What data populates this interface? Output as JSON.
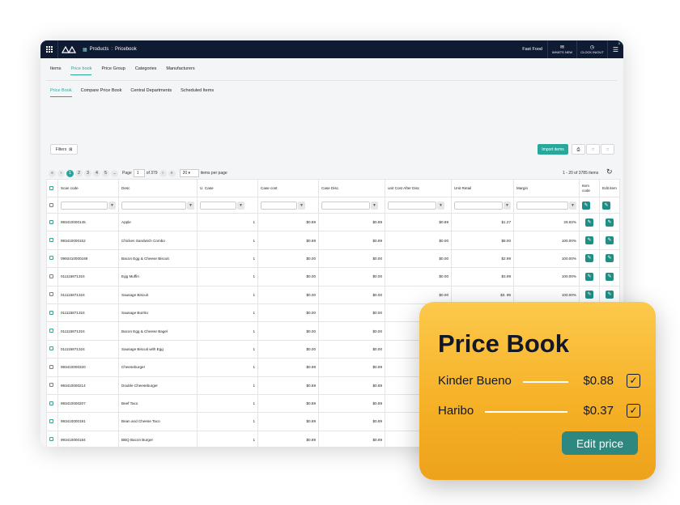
{
  "topbar": {
    "breadcrumb_root": "Products",
    "breadcrumb_sep": ":",
    "breadcrumb_page": "Pricebook",
    "store": "Fast Food",
    "whats_new": "WHAT'S NEW",
    "clock": "CLOCK IN/OUT",
    "badge": "0"
  },
  "tabs_main": [
    "Items",
    "Price book",
    "Price Group",
    "Categories",
    "Manufacturers"
  ],
  "tabs_sub": [
    "Price Book",
    "Compare Price Book",
    "Central Departments",
    "Scheduled Items"
  ],
  "filters_label": "Filters",
  "import_label": "Import items",
  "pager": {
    "pages": [
      "1",
      "2",
      "3",
      "4",
      "5",
      "..."
    ],
    "page_label": "Page",
    "page_value": "1",
    "of_label": "of 379",
    "per_page": "20",
    "per_page_label": "items per page",
    "range": "1 - 20 of 3785 items"
  },
  "columns": [
    "Scan code",
    "Desc",
    "U. Case",
    "Case cost",
    "Case Disc.",
    "unit Cost After Disc",
    "Unit Retail",
    "Margin",
    "Item code",
    "Edit item"
  ],
  "rows": [
    {
      "scan": "993410000145",
      "desc": "Apple",
      "ucase": "1",
      "cost": "$0.89",
      "disc": "$0.89",
      "unit": "$0.89",
      "retail": "$1.27",
      "margin": "29.92%"
    },
    {
      "scan": "993410000152",
      "desc": "Chicken Sandwich Combo",
      "ucase": "1",
      "cost": "$0.89",
      "disc": "$0.89",
      "unit": "$0.00",
      "retail": "$8.00",
      "margin": "100.00%"
    },
    {
      "scan": "0993410000169",
      "desc": "Bacon Egg & Cheese Biscuit",
      "ucase": "1",
      "cost": "$0.00",
      "disc": "$0.00",
      "unit": "$0.00",
      "retail": "$2.99",
      "margin": "100.00%"
    },
    {
      "scan": "011115871324",
      "desc": "Egg Muffin",
      "ucase": "1",
      "cost": "$0.00",
      "disc": "$0.00",
      "unit": "$0.00",
      "retail": "$3.99",
      "margin": "100.00%"
    },
    {
      "scan": "011115871324",
      "desc": "Sausage Biscuit",
      "ucase": "1",
      "cost": "$0.00",
      "disc": "$0.00",
      "unit": "$0.00",
      "retail": "$3. 99",
      "margin": "100.00%"
    },
    {
      "scan": "011115871324",
      "desc": "Sausage Burrito",
      "ucase": "1",
      "cost": "$0.00",
      "disc": "$0.00",
      "unit": "$0.00",
      "retail": "$3. 99",
      "margin": "100.00%"
    },
    {
      "scan": "011115871324",
      "desc": "Bacon Egg & Cheese Bagel",
      "ucase": "1",
      "cost": "$0.00",
      "disc": "$0.00",
      "unit": "$0.00",
      "retail": "$3.49",
      "margin": "100.00%"
    },
    {
      "scan": "011115871324",
      "desc": "Sausage Biscuit with Egg",
      "ucase": "1",
      "cost": "$0.00",
      "disc": "$0.00",
      "unit": "",
      "retail": "",
      "margin": ""
    },
    {
      "scan": "993410000320",
      "desc": "Cheeseburger",
      "ucase": "1",
      "cost": "$0.99",
      "disc": "$0.99",
      "unit": "",
      "retail": "",
      "margin": ""
    },
    {
      "scan": "993410000214",
      "desc": "Double Cheeseburger",
      "ucase": "1",
      "cost": "$0.89",
      "disc": "$0.89",
      "unit": "",
      "retail": "",
      "margin": ""
    },
    {
      "scan": "993410000207",
      "desc": "Beef Taco",
      "ucase": "1",
      "cost": "$0.89",
      "disc": "$0.89",
      "unit": "",
      "retail": "",
      "margin": ""
    },
    {
      "scan": "993410000191",
      "desc": "Bean and Cheese Taco",
      "ucase": "1",
      "cost": "$0.89",
      "disc": "$0.89",
      "unit": "",
      "retail": "",
      "margin": ""
    },
    {
      "scan": "993410000184",
      "desc": "BBQ Bacon Burger",
      "ucase": "1",
      "cost": "$0.89",
      "disc": "$0.89",
      "unit": "",
      "retail": "",
      "margin": ""
    }
  ],
  "card": {
    "title": "Price Book",
    "items": [
      {
        "name": "Kinder Bueno",
        "price": "$0.88"
      },
      {
        "name": "Haribo",
        "price": "$0.37"
      }
    ],
    "button": "Edit price"
  },
  "colors": {
    "accent": "#2aa79b",
    "topbar": "#0f1a33",
    "card": "#f5b025"
  }
}
